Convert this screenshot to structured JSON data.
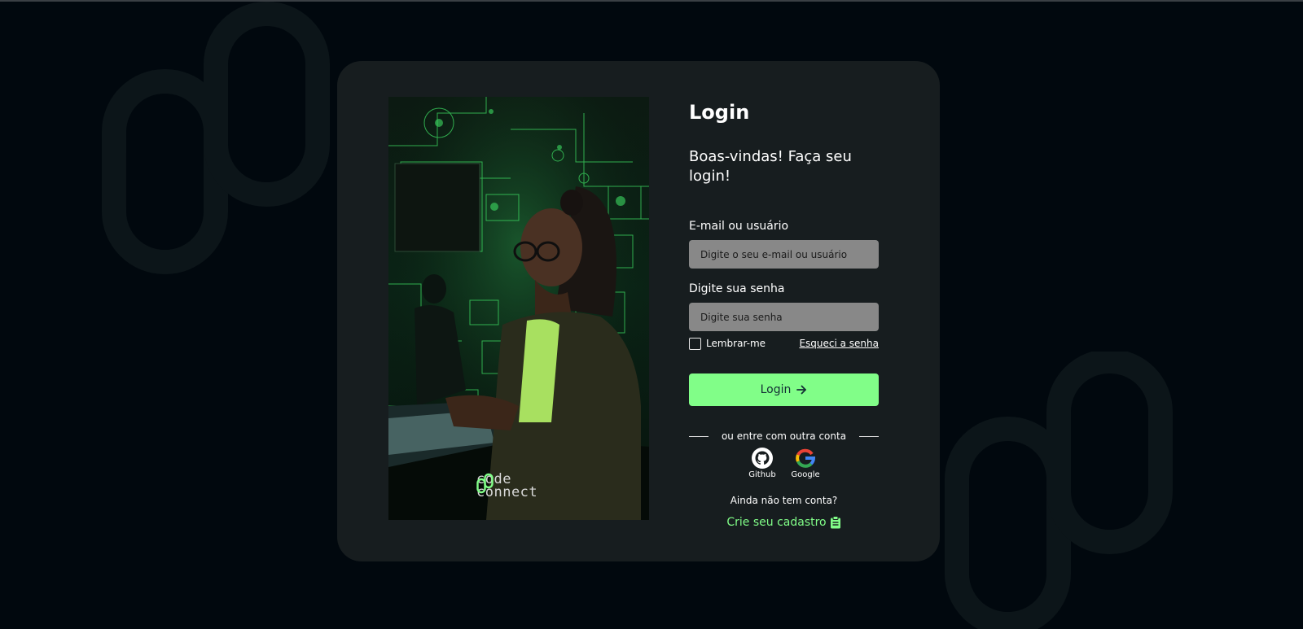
{
  "colors": {
    "background": "#01080e",
    "card": "#171d1f",
    "accent": "#81fe88",
    "input_bg": "#888888"
  },
  "hero": {
    "brand_line1": "code",
    "brand_line2": "connect"
  },
  "login": {
    "title": "Login",
    "welcome": "Boas-vindas! Faça seu login!",
    "email_label": "E-mail ou usuário",
    "email_placeholder": "Digite o seu e-mail ou usuário",
    "password_label": "Digite sua senha",
    "password_placeholder": "Digite sua senha",
    "remember_label": "Lembrar-me",
    "forgot_label": "Esqueci a senha",
    "button_label": "Login",
    "button_icon": "arrow-right-icon"
  },
  "social": {
    "divider_text": "ou entre com outra conta",
    "providers": [
      {
        "label": "Github",
        "icon": "github-icon"
      },
      {
        "label": "Google",
        "icon": "google-icon"
      }
    ]
  },
  "signup": {
    "question": "Ainda não tem conta?",
    "link_label": "Crie seu cadastro",
    "icon": "clipboard-icon"
  }
}
